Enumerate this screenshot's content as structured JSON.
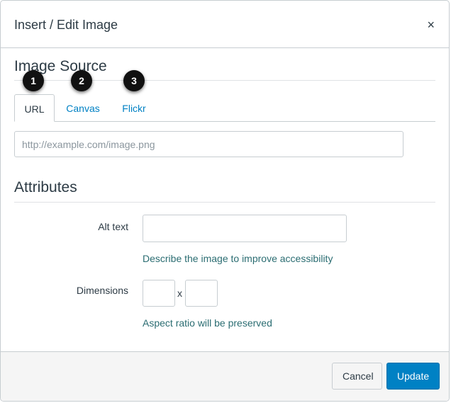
{
  "dialog": {
    "title": "Insert / Edit Image",
    "close_glyph": "×"
  },
  "image_source": {
    "heading": "Image Source",
    "tabs": [
      {
        "label": "URL",
        "active": true
      },
      {
        "label": "Canvas",
        "active": false
      },
      {
        "label": "Flickr",
        "active": false
      }
    ],
    "badges": [
      "1",
      "2",
      "3"
    ],
    "url_input": {
      "value": "",
      "placeholder": "http://example.com/image.png"
    }
  },
  "attributes": {
    "heading": "Attributes",
    "alt_text_label": "Alt text",
    "alt_text_value": "",
    "alt_text_hint": "Describe the image to improve accessibility",
    "dimensions_label": "Dimensions",
    "width_value": "",
    "height_value": "",
    "dimensions_separator": "x",
    "dimensions_hint": "Aspect ratio will be preserved"
  },
  "footer": {
    "cancel_label": "Cancel",
    "update_label": "Update"
  },
  "colors": {
    "link": "#0081c4",
    "primary_button": "#0081c4",
    "hint_text": "#2b6d72",
    "badge": "#111111"
  },
  "icons": {
    "close": "close-icon"
  }
}
